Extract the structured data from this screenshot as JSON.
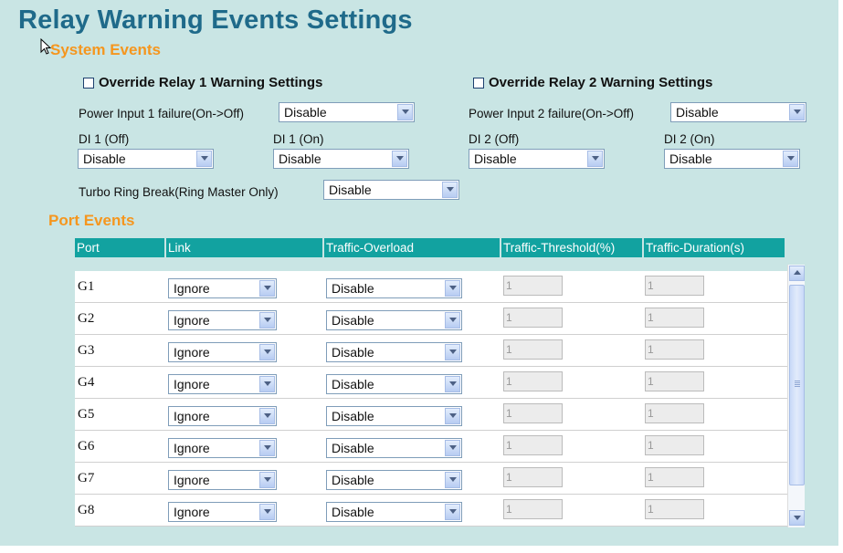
{
  "page_title": "Relay Warning Events Settings",
  "system_events": {
    "title": "System Events",
    "override_relay1_label": "Override Relay 1 Warning Settings",
    "override_relay1_checked": false,
    "override_relay2_label": "Override Relay 2 Warning Settings",
    "override_relay2_checked": false,
    "power1": {
      "label": "Power Input 1 failure(On->Off)",
      "value": "Disable"
    },
    "power2": {
      "label": "Power Input 2 failure(On->Off)",
      "value": "Disable"
    },
    "di1_off": {
      "label": "DI 1 (Off)",
      "value": "Disable"
    },
    "di1_on": {
      "label": "DI 1 (On)",
      "value": "Disable"
    },
    "di2_off": {
      "label": "DI 2 (Off)",
      "value": "Disable"
    },
    "di2_on": {
      "label": "DI 2 (On)",
      "value": "Disable"
    },
    "turbo": {
      "label": "Turbo Ring Break(Ring Master Only)",
      "value": "Disable"
    }
  },
  "port_events": {
    "title": "Port Events",
    "columns": [
      "Port",
      "Link",
      "Traffic-Overload",
      "Traffic-Threshold(%)",
      "Traffic-Duration(s)"
    ],
    "rows": [
      {
        "port": "G1",
        "link": "Ignore",
        "overload": "Disable",
        "threshold": "1",
        "duration": "1"
      },
      {
        "port": "G2",
        "link": "Ignore",
        "overload": "Disable",
        "threshold": "1",
        "duration": "1"
      },
      {
        "port": "G3",
        "link": "Ignore",
        "overload": "Disable",
        "threshold": "1",
        "duration": "1"
      },
      {
        "port": "G4",
        "link": "Ignore",
        "overload": "Disable",
        "threshold": "1",
        "duration": "1"
      },
      {
        "port": "G5",
        "link": "Ignore",
        "overload": "Disable",
        "threshold": "1",
        "duration": "1"
      },
      {
        "port": "G6",
        "link": "Ignore",
        "overload": "Disable",
        "threshold": "1",
        "duration": "1"
      },
      {
        "port": "G7",
        "link": "Ignore",
        "overload": "Disable",
        "threshold": "1",
        "duration": "1"
      },
      {
        "port": "G8",
        "link": "Ignore",
        "overload": "Disable",
        "threshold": "1",
        "duration": "1"
      }
    ]
  },
  "colors": {
    "background": "#c9e5e4",
    "title": "#1f6a8a",
    "section_title": "#f5961e",
    "table_header": "#12a2a0"
  }
}
